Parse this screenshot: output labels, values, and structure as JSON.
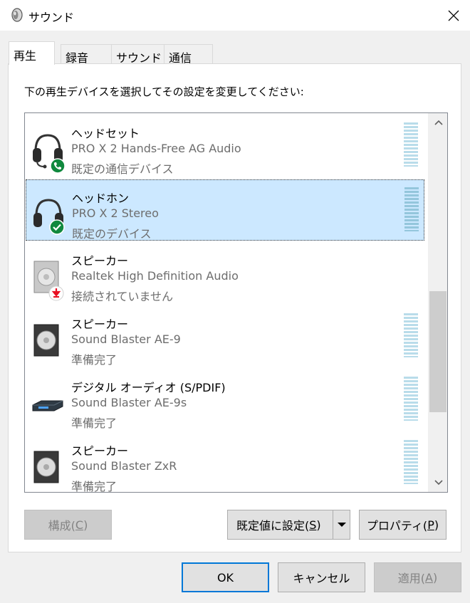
{
  "window": {
    "title": "サウンド",
    "close_label": "×"
  },
  "tabs": [
    {
      "label": "再生",
      "active": true
    },
    {
      "label": "録音",
      "active": false
    },
    {
      "label": "サウンド",
      "active": false
    },
    {
      "label": "通信",
      "active": false
    }
  ],
  "instruction": "下の再生デバイスを選択してその設定を変更してください:",
  "devices": [
    {
      "name": "ヘッドセット",
      "desc": "PRO X 2 Hands-Free AG Audio",
      "status": "既定の通信デバイス",
      "icon": "headset-icon",
      "badge": "phone-badge-icon",
      "selected": false
    },
    {
      "name": "ヘッドホン",
      "desc": "PRO X 2 Stereo",
      "status": "既定のデバイス",
      "icon": "headphones-icon",
      "badge": "check-badge-icon",
      "selected": true
    },
    {
      "name": "スピーカー",
      "desc": "Realtek High Definition Audio",
      "status": "接続されていません",
      "icon": "speaker-icon",
      "badge": "disconnected-badge-icon",
      "selected": false
    },
    {
      "name": "スピーカー",
      "desc": "Sound Blaster AE-9",
      "status": "準備完了",
      "icon": "speaker-icon",
      "badge": "",
      "selected": false
    },
    {
      "name": "デジタル オーディオ (S/PDIF)",
      "desc": "Sound Blaster AE-9s",
      "status": "準備完了",
      "icon": "digital-audio-icon",
      "badge": "",
      "selected": false
    },
    {
      "name": "スピーカー",
      "desc": "Sound Blaster ZxR",
      "status": "準備完了",
      "icon": "speaker-icon",
      "badge": "",
      "selected": false
    }
  ],
  "buttons": {
    "configure": {
      "label": "構成(",
      "key": "C",
      "suffix": ")"
    },
    "set_default": {
      "label": "既定値に設定(",
      "key": "S",
      "suffix": ")"
    },
    "properties": {
      "label": "プロパティ(",
      "key": "P",
      "suffix": ")"
    },
    "ok": "OK",
    "cancel": "キャンセル",
    "apply": {
      "label": "適用(",
      "key": "A",
      "suffix": ")"
    }
  },
  "colors": {
    "selection": "#cce8ff",
    "accent": "#0078d7",
    "badge_green": "#10893e",
    "badge_red": "#e81123"
  }
}
